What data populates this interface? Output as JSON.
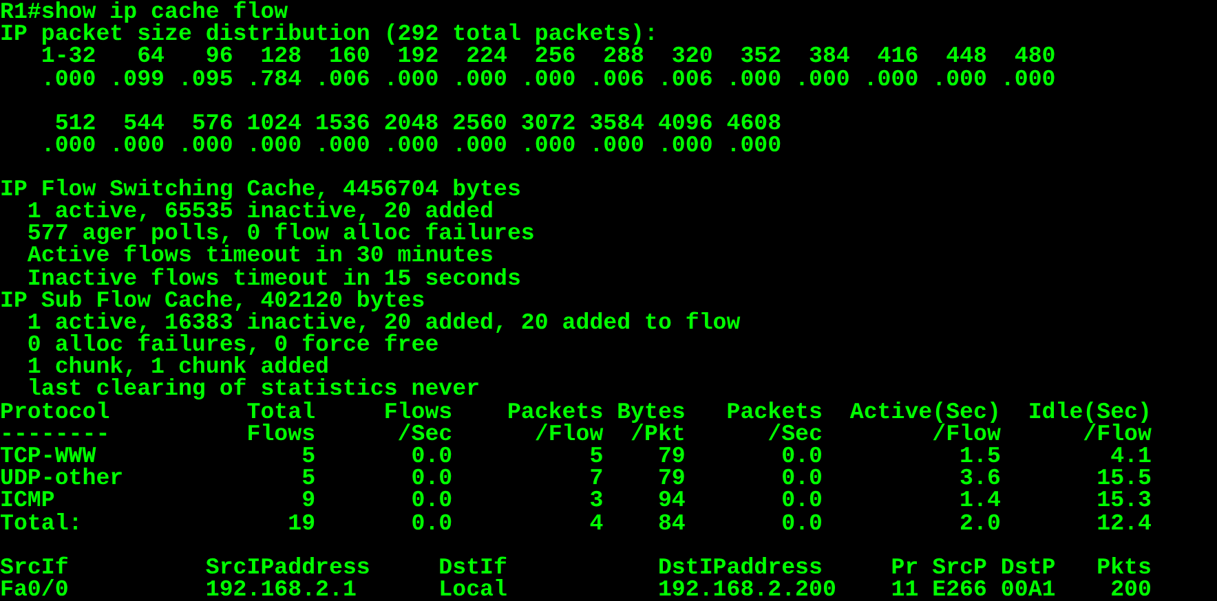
{
  "terminal": {
    "lines": [
      {
        "kind": "text",
        "text": "R1#show ip cache flow"
      },
      {
        "kind": "text",
        "text": "IP packet size distribution (292 total packets):"
      },
      {
        "kind": "text",
        "text": "   1-32   64   96  128  160  192  224  256  288  320  352  384  416  448  480"
      },
      {
        "kind": "text",
        "text": "   .000 .099 .095 .784 .006 .000 .000 .000 .006 .006 .000 .000 .000 .000 .000"
      },
      {
        "kind": "blank"
      },
      {
        "kind": "text",
        "text": "    512  544  576 1024 1536 2048 2560 3072 3584 4096 4608"
      },
      {
        "kind": "text",
        "text": "   .000 .000 .000 .000 .000 .000 .000 .000 .000 .000 .000"
      },
      {
        "kind": "blank"
      },
      {
        "kind": "text",
        "text": "IP Flow Switching Cache, 4456704 bytes"
      },
      {
        "kind": "text",
        "text": "  1 active, 65535 inactive, 20 added"
      },
      {
        "kind": "text",
        "text": "  577 ager polls, 0 flow alloc failures"
      },
      {
        "kind": "text",
        "text": "  Active flows timeout in 30 minutes"
      },
      {
        "kind": "text",
        "text": "  Inactive flows timeout in 15 seconds"
      },
      {
        "kind": "text",
        "text": "IP Sub Flow Cache, 402120 bytes"
      },
      {
        "kind": "text",
        "text": "  1 active, 16383 inactive, 20 added, 20 added to flow"
      },
      {
        "kind": "text",
        "text": "  0 alloc failures, 0 force free"
      },
      {
        "kind": "text",
        "text": "  1 chunk, 1 chunk added"
      },
      {
        "kind": "text",
        "text": "  last clearing of statistics never"
      },
      {
        "kind": "text",
        "text": "Protocol          Total     Flows    Packets Bytes   Packets  Active(Sec)  Idle(Sec)"
      },
      {
        "kind": "text",
        "text": "--------          Flows      /Sec      /Flow  /Pkt      /Sec        /Flow      /Flow"
      },
      {
        "kind": "text",
        "text": "TCP-WWW               5       0.0          5    79       0.0          1.5        4.1"
      },
      {
        "kind": "text",
        "text": "UDP-other             5       0.0          7    79       0.0          3.6       15.5"
      },
      {
        "kind": "text",
        "text": "ICMP                  9       0.0          3    94       0.0          1.4       15.3"
      },
      {
        "kind": "text",
        "text": "Total:               19       0.0          4    84       0.0          2.0       12.4"
      },
      {
        "kind": "blank"
      },
      {
        "kind": "text",
        "text": "SrcIf          SrcIPaddress     DstIf           DstIPaddress     Pr SrcP DstP   Pkts"
      },
      {
        "kind": "text",
        "text": "Fa0/0          192.168.2.1      Local           192.168.2.200    11 E266 00A1    200"
      }
    ]
  }
}
